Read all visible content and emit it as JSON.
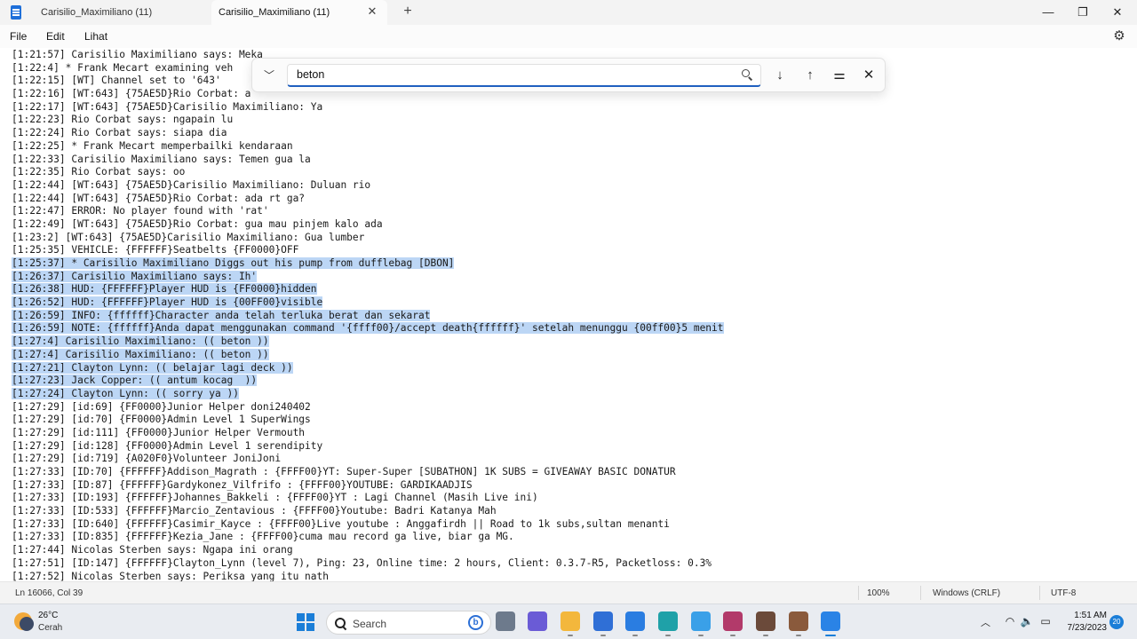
{
  "window": {
    "tabs": [
      {
        "title": "Carisilio_Maximiliano (11)",
        "active": false
      },
      {
        "title": "Carisilio_Maximiliano (11)",
        "active": true
      }
    ],
    "new_tab": "+",
    "minimize": "—",
    "maximize": "❐",
    "close": "✕"
  },
  "menu": {
    "items": [
      "File",
      "Edit",
      "Lihat"
    ]
  },
  "find": {
    "query": "beton"
  },
  "editor": {
    "lines": [
      {
        "pre": "[1:21:57] Carisilio Maximiliano says: Meka",
        "hl": "",
        "post": ""
      },
      {
        "pre": "[1:22:4] * Frank Mecart examining veh",
        "hl": "",
        "post": ""
      },
      {
        "pre": "[1:22:15] [WT] Channel set to '643'",
        "hl": "",
        "post": ""
      },
      {
        "pre": "[1:22:16] [WT:643] {75AE5D}Rio Corbat: a",
        "hl": "",
        "post": ""
      },
      {
        "pre": "[1:22:17] [WT:643] {75AE5D}Carisilio Maximiliano: Ya",
        "hl": "",
        "post": ""
      },
      {
        "pre": "[1:22:23] Rio Corbat says: ngapain lu",
        "hl": "",
        "post": ""
      },
      {
        "pre": "[1:22:24] Rio Corbat says: siapa dia",
        "hl": "",
        "post": ""
      },
      {
        "pre": "[1:22:25] * Frank Mecart memperbailki kendaraan",
        "hl": "",
        "post": ""
      },
      {
        "pre": "[1:22:33] Carisilio Maximiliano says: Temen gua la",
        "hl": "",
        "post": ""
      },
      {
        "pre": "[1:22:35] Rio Corbat says: oo",
        "hl": "",
        "post": ""
      },
      {
        "pre": "[1:22:44] [WT:643] {75AE5D}Carisilio Maximiliano: Duluan rio",
        "hl": "",
        "post": ""
      },
      {
        "pre": "[1:22:44] [WT:643] {75AE5D}Rio Corbat: ada rt ga?",
        "hl": "",
        "post": ""
      },
      {
        "pre": "[1:22:47] ERROR: No player found with 'rat'",
        "hl": "",
        "post": ""
      },
      {
        "pre": "[1:22:49] [WT:643] {75AE5D}Rio Corbat: gua mau pinjem kalo ada",
        "hl": "",
        "post": ""
      },
      {
        "pre": "[1:23:2] [WT:643] {75AE5D}Carisilio Maximiliano: Gua lumber",
        "hl": "",
        "post": ""
      },
      {
        "pre": "[1:25:35] VEHICLE: {FFFFFF}Seatbelts {FF0000}OFF",
        "hl": "",
        "post": ""
      },
      {
        "pre": "",
        "hl": "[1:25:37] * Carisilio Maximiliano Diggs out his pump from dufflebag [DBON]",
        "post": ""
      },
      {
        "pre": "",
        "hl": "[1:26:37] Carisilio Maximiliano says: Ih'",
        "post": ""
      },
      {
        "pre": "",
        "hl": "[1:26:38] HUD: {FFFFFF}Player HUD is {FF0000}hidden",
        "post": ""
      },
      {
        "pre": "",
        "hl": "[1:26:52] HUD: {FFFFFF}Player HUD is {00FF00}visible",
        "post": ""
      },
      {
        "pre": "",
        "hl": "[1:26:59] INFO: {ffffff}Character anda telah terluka berat dan sekarat",
        "post": ""
      },
      {
        "pre": "",
        "hl": "[1:26:59] NOTE: {ffffff}Anda dapat menggunakan command '{ffff00}/accept death{ffffff}' setelah menunggu {00ff00}5 menit",
        "post": ""
      },
      {
        "pre": "",
        "hl": "[1:27:4] Carisilio Maximiliano: (( beton ))",
        "post": ""
      },
      {
        "pre": "",
        "hl": "[1:27:4] Carisilio Maximiliano: (( beton ))",
        "post": ""
      },
      {
        "pre": "",
        "hl": "[1:27:21] Clayton Lynn: (( belajar lagi deck ))",
        "post": ""
      },
      {
        "pre": "",
        "hl": "[1:27:23] Jack Copper: (( antum kocag  ))",
        "post": ""
      },
      {
        "pre": "",
        "hl": "[1:27:24] Clayton Lynn: (( sorry ya ))",
        "post": ""
      },
      {
        "pre": "[1:27:29] [id:69] {FF0000}Junior Helper doni240402",
        "hl": "",
        "post": ""
      },
      {
        "pre": "[1:27:29] [id:70] {FF0000}Admin Level 1 SuperWings",
        "hl": "",
        "post": ""
      },
      {
        "pre": "[1:27:29] [id:111] {FF0000}Junior Helper Vermouth",
        "hl": "",
        "post": ""
      },
      {
        "pre": "[1:27:29] [id:128] {FF0000}Admin Level 1 serendipity",
        "hl": "",
        "post": ""
      },
      {
        "pre": "[1:27:29] [id:719] {A020F0}Volunteer JoniJoni",
        "hl": "",
        "post": ""
      },
      {
        "pre": "[1:27:33] [ID:70] {FFFFFF}Addison_Magrath : {FFFF00}YT: Super-Super [SUBATHON] 1K SUBS = GIVEAWAY BASIC DONATUR",
        "hl": "",
        "post": ""
      },
      {
        "pre": "[1:27:33] [ID:87] {FFFFFF}Gardykonez_Vilfrifo : {FFFF00}YOUTUBE: GARDIKAADJIS",
        "hl": "",
        "post": ""
      },
      {
        "pre": "[1:27:33] [ID:193] {FFFFFF}Johannes_Bakkeli : {FFFF00}YT : Lagi Channel (Masih Live ini)",
        "hl": "",
        "post": ""
      },
      {
        "pre": "[1:27:33] [ID:533] {FFFFFF}Marcio_Zentavious : {FFFF00}Youtube: Badri Katanya Mah",
        "hl": "",
        "post": ""
      },
      {
        "pre": "[1:27:33] [ID:640] {FFFFFF}Casimir_Kayce : {FFFF00}Live youtube : Anggafirdh || Road to 1k subs,sultan menanti",
        "hl": "",
        "post": ""
      },
      {
        "pre": "[1:27:33] [ID:835] {FFFFFF}Kezia_Jane : {FFFF00}cuma mau record ga live, biar ga MG.",
        "hl": "",
        "post": ""
      },
      {
        "pre": "[1:27:44] Nicolas Sterben says: Ngapa ini orang",
        "hl": "",
        "post": ""
      },
      {
        "pre": "[1:27:51] [ID:147] {FFFFFF}Clayton_Lynn (level 7), Ping: 23, Online time: 2 hours, Client: 0.3.7-R5, Packetloss: 0.3%",
        "hl": "",
        "post": ""
      },
      {
        "pre": "[1:27:52] Nicolas Sterben says: Periksa yang itu nath",
        "hl": "",
        "post": ""
      }
    ]
  },
  "status": {
    "position": "Ln 16066, Col 39",
    "zoom": "100%",
    "line_ending": "Windows (CRLF)",
    "encoding": "UTF-8"
  },
  "taskbar": {
    "weather_temp": "26°C",
    "weather_desc": "Cerah",
    "search_label": "Search",
    "time": "1:51 AM",
    "date": "7/23/2023",
    "notifications": "20",
    "apps": [
      {
        "name": "task-view",
        "color": "#6d7a8c"
      },
      {
        "name": "teams-chat",
        "color": "#6a5bd6"
      },
      {
        "name": "file-explorer",
        "color": "#f3b73c"
      },
      {
        "name": "microsoft-store",
        "color": "#2f6fd6"
      },
      {
        "name": "mshp-app",
        "color": "#2a7de1"
      },
      {
        "name": "edge-browser",
        "color": "#1fa1a8"
      },
      {
        "name": "bug-app",
        "color": "#3aa0e8"
      },
      {
        "name": "winrar",
        "color": "#b23a6a"
      },
      {
        "name": "game-app-1",
        "color": "#6b4a3a"
      },
      {
        "name": "game-app-2",
        "color": "#8a5a3c"
      },
      {
        "name": "notepad",
        "color": "#2a83e6"
      }
    ]
  },
  "colors": {
    "selection": "#bcd6f5",
    "accent": "#1f5fbf"
  }
}
